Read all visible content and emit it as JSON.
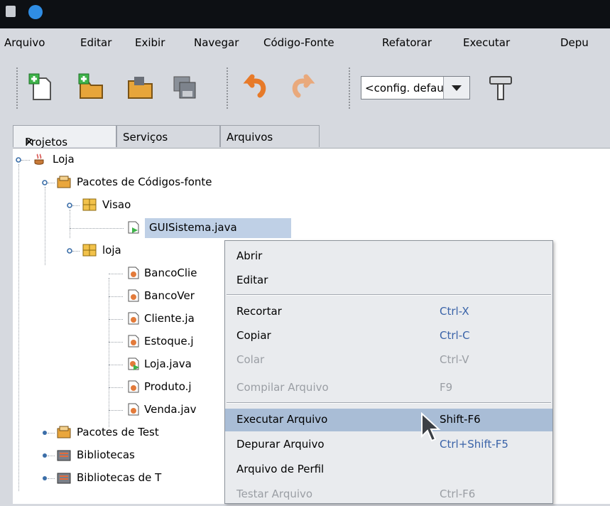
{
  "menubar": [
    "Arquivo",
    "Editar",
    "Exibir",
    "Navegar",
    "Código-Fonte",
    "Refatorar",
    "Executar",
    "Depu"
  ],
  "toolbar": {
    "config_value": "<config. default>"
  },
  "tabs": [
    "Projetos",
    "Serviços",
    "Arquivos"
  ],
  "tree": {
    "project": "Loja",
    "source_packages": "Pacotes de Códigos-fonte",
    "pkg_visao": "Visao",
    "file_gui": "GUISistema.java",
    "pkg_loja": "loja",
    "files": [
      "BancoClie",
      "BancoVer",
      "Cliente.ja",
      "Estoque.j",
      "Loja.java",
      "Produto.j",
      "Venda.jav"
    ],
    "test_packages": "Pacotes de Test",
    "libraries": "Bibliotecas",
    "test_libraries": "Bibliotecas de T"
  },
  "context_menu": [
    {
      "label": "Abrir",
      "shortcut": ""
    },
    {
      "label": "Editar",
      "shortcut": ""
    },
    {
      "label": "Recortar",
      "shortcut": "Ctrl-X"
    },
    {
      "label": "Copiar",
      "shortcut": "Ctrl-C"
    },
    {
      "label": "Colar",
      "shortcut": "Ctrl-V"
    },
    {
      "label": "Compilar Arquivo",
      "shortcut": "F9"
    },
    {
      "label": "Executar Arquivo",
      "shortcut": "Shift-F6"
    },
    {
      "label": "Depurar Arquivo",
      "shortcut": "Ctrl+Shift-F5"
    },
    {
      "label": "Arquivo de Perfil",
      "shortcut": ""
    },
    {
      "label": "Testar Arquivo",
      "shortcut": "Ctrl-F6"
    }
  ],
  "colors": {
    "accent_shortcut": "#3a63a8",
    "highlight": "#a9bdd6",
    "selection": "#bfd0e6"
  }
}
